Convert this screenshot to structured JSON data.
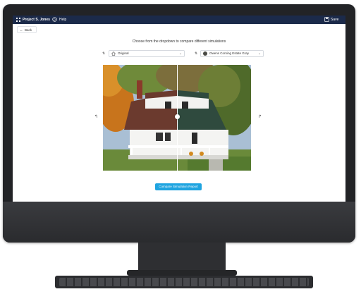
{
  "topbar": {
    "project_name": "Project S. Jones",
    "help_label": "Help",
    "save_label": "Save"
  },
  "back_label": "Back",
  "instruction": "Choose from the dropdown to compare different simulations",
  "left_select": {
    "value": "Original"
  },
  "right_select": {
    "value": "Owens Corning Estate Gray"
  },
  "compare_button": "Compare Simulation Report",
  "colors": {
    "topbar": "#1b2a4a",
    "accent": "#1fa4e0",
    "roof_original": "#6b3a2e",
    "roof_simulated": "#2f4a3e"
  },
  "icons": [
    "grid-icon",
    "help-icon",
    "save-icon",
    "back-arrow-icon",
    "home-icon",
    "chevron-down-icon",
    "swap-arrow-icon",
    "slider-handle-icon"
  ]
}
